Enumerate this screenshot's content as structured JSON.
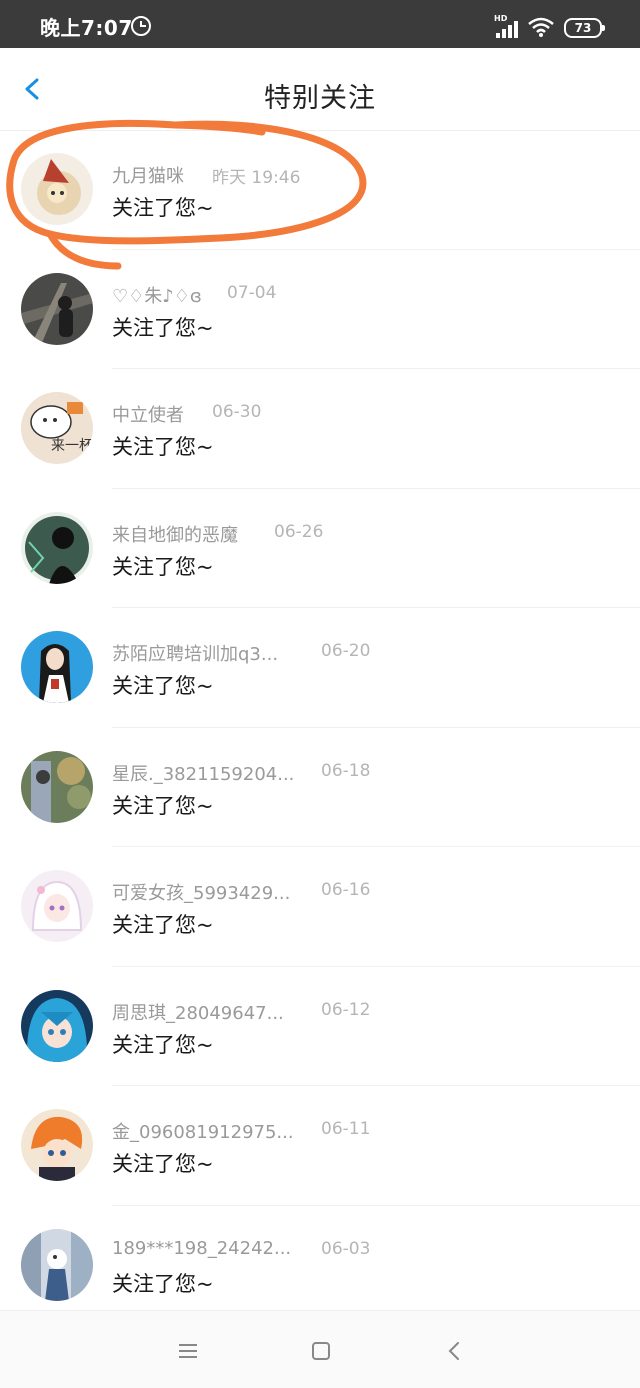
{
  "status_bar": {
    "time": "晚上7:07",
    "battery": "73",
    "network": "HD"
  },
  "header": {
    "title": "特别关注"
  },
  "rows": [
    {
      "name": "九月猫咪",
      "date": "昨天 19:46",
      "message": "关注了您~"
    },
    {
      "name": "♡♢朱♪♢ɞ",
      "date": "07-04",
      "message": "关注了您~"
    },
    {
      "name": "中立使者",
      "date": "06-30",
      "message": "关注了您~"
    },
    {
      "name": "来自地御的恶魔",
      "date": "06-26",
      "message": "关注了您~"
    },
    {
      "name": "苏陌应聘培训加q3...",
      "date": "06-20",
      "message": "关注了您~"
    },
    {
      "name": "星辰._3821159204...",
      "date": "06-18",
      "message": "关注了您~"
    },
    {
      "name": "可爱女孩_5993429...",
      "date": "06-16",
      "message": "关注了您~"
    },
    {
      "name": "周思琪_28049647...",
      "date": "06-12",
      "message": "关注了您~"
    },
    {
      "name": "金_096081912975...",
      "date": "06-11",
      "message": "关注了您~"
    },
    {
      "name": "189***198_24242...",
      "date": "06-03",
      "message": "关注了您~"
    }
  ],
  "colors": {
    "accent": "#1a8fe3",
    "highlight": "#f27a3a",
    "status_bar": "#3b3b3b"
  }
}
